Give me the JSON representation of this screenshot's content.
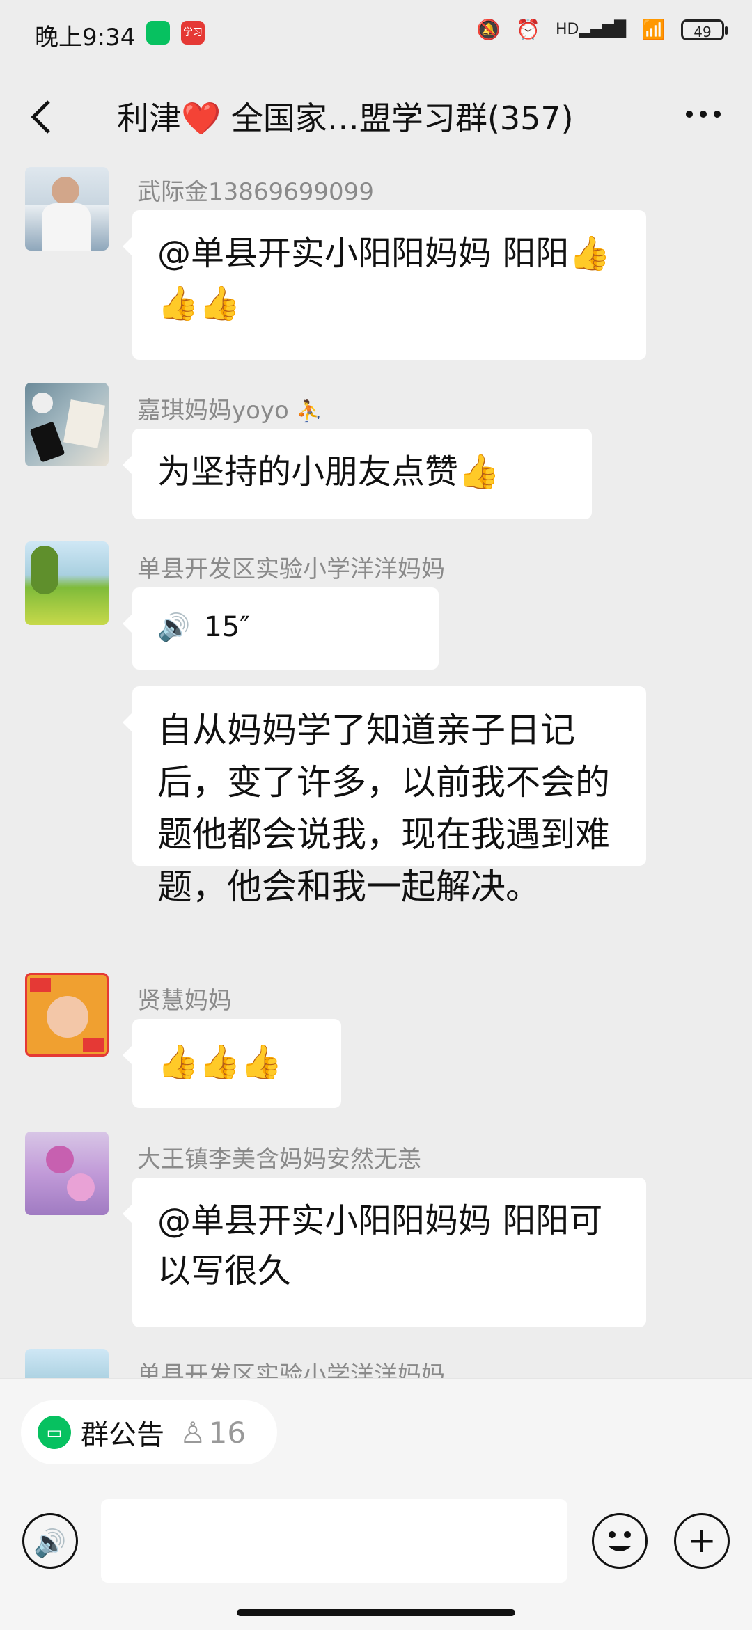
{
  "status_bar": {
    "time": "晚上9:34",
    "xuexi_label": "学习",
    "hd": "HD",
    "battery": "49"
  },
  "header": {
    "back_icon": "chevron-left-icon",
    "title": "利津❤️ 全国家…盟学习群(357)",
    "more_icon": "more-icon"
  },
  "messages": [
    {
      "sender": "武际金13869699099",
      "text": "@单县开实小阳阳妈妈  阳阳👍👍👍"
    },
    {
      "sender": "嘉琪妈妈yoyo",
      "text": "为坚持的小朋友点赞👍"
    },
    {
      "sender": "单县开发区实验小学洋洋妈妈",
      "voice_duration": "15″",
      "text": "自从妈妈学了知道亲子日记后，变了许多，以前我不会的题他都会说我，现在我遇到难题，他会和我一起解决。"
    },
    {
      "sender": "贤慧妈妈",
      "text": "👍👍👍"
    },
    {
      "sender": "大王镇李美含妈妈安然无恙",
      "text": "@单县开实小阳阳妈妈  阳阳可以写很久"
    },
    {
      "sender": "单县开发区实验小学洋洋妈妈"
    }
  ],
  "bottom": {
    "notice_label": "群公告",
    "notice_count": "16"
  },
  "colors": {
    "background": "#ededed",
    "bubble": "#ffffff",
    "wechat_green": "#07c160"
  }
}
